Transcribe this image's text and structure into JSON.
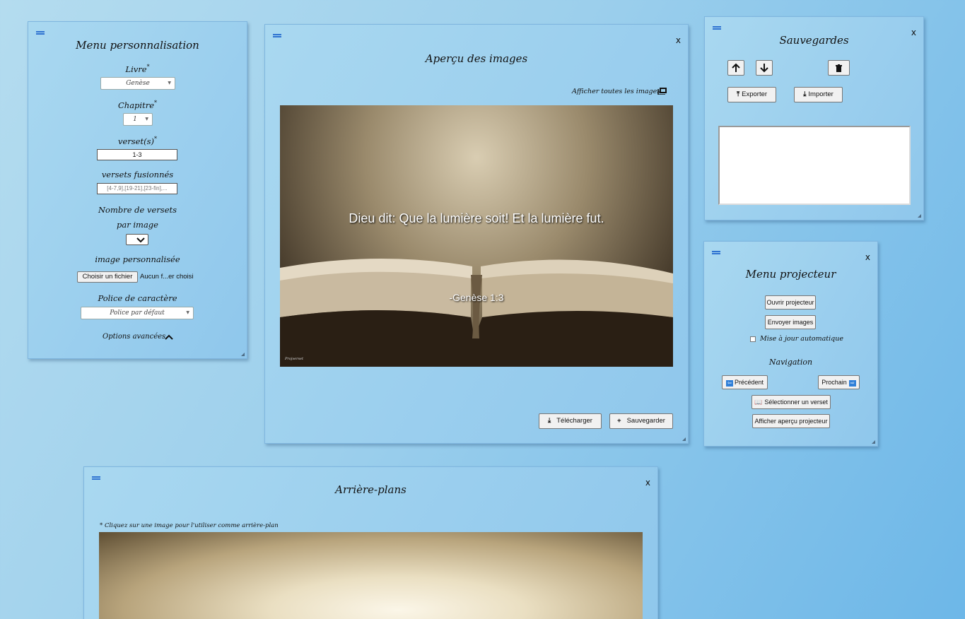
{
  "menu": {
    "title": "Menu personnalisation",
    "livre_label": "Livre",
    "livre_value": "Genèse",
    "chapitre_label": "Chapitre",
    "chapitre_value": "1",
    "versets_label": "verset(s)",
    "versets_value": "1-3",
    "fusion_label": "versets fusionnés",
    "fusion_placeholder": "[4-7,9],[19-21],[23-fin],...",
    "nombre_label_1": "Nombre de versets",
    "nombre_label_2": "par image",
    "image_label": "image personnalisée",
    "file_button": "Choisir un fichier",
    "file_status": "Aucun f...er choisi",
    "police_label": "Police de caractère",
    "police_value": "Police par défaut",
    "advanced": "Options avancées"
  },
  "preview": {
    "title": "Aperçu des images",
    "close": "x",
    "show_all": "Afficher toutes les images",
    "verse_text": "Dieu dit: Que la lumière soit! Et la lumière fut.",
    "reference": "-Genèse 1:3",
    "watermark": "Projverset",
    "download": "Télécharger",
    "save": "Sauvegarder"
  },
  "saves": {
    "title": "Sauvegardes",
    "close": "x",
    "export": "Exporter",
    "import": "Importer"
  },
  "projector": {
    "title": "Menu projecteur",
    "close": "x",
    "open": "Ouvrir projecteur",
    "send": "Envoyer images",
    "auto_update": "Mise à jour automatique",
    "nav_label": "Navigation",
    "prev": "Précédent",
    "next": "Prochain",
    "select_verse": "Sélectionner un verset",
    "show_preview": "Afficher aperçu projecteur"
  },
  "backgrounds": {
    "title": "Arrière-plans",
    "close": "x",
    "hint": "* Cliquez sur une image pour l'utiliser comme arrière-plan"
  },
  "colors": {
    "accent": "#2f73d1",
    "panel": "#9ccfec"
  }
}
